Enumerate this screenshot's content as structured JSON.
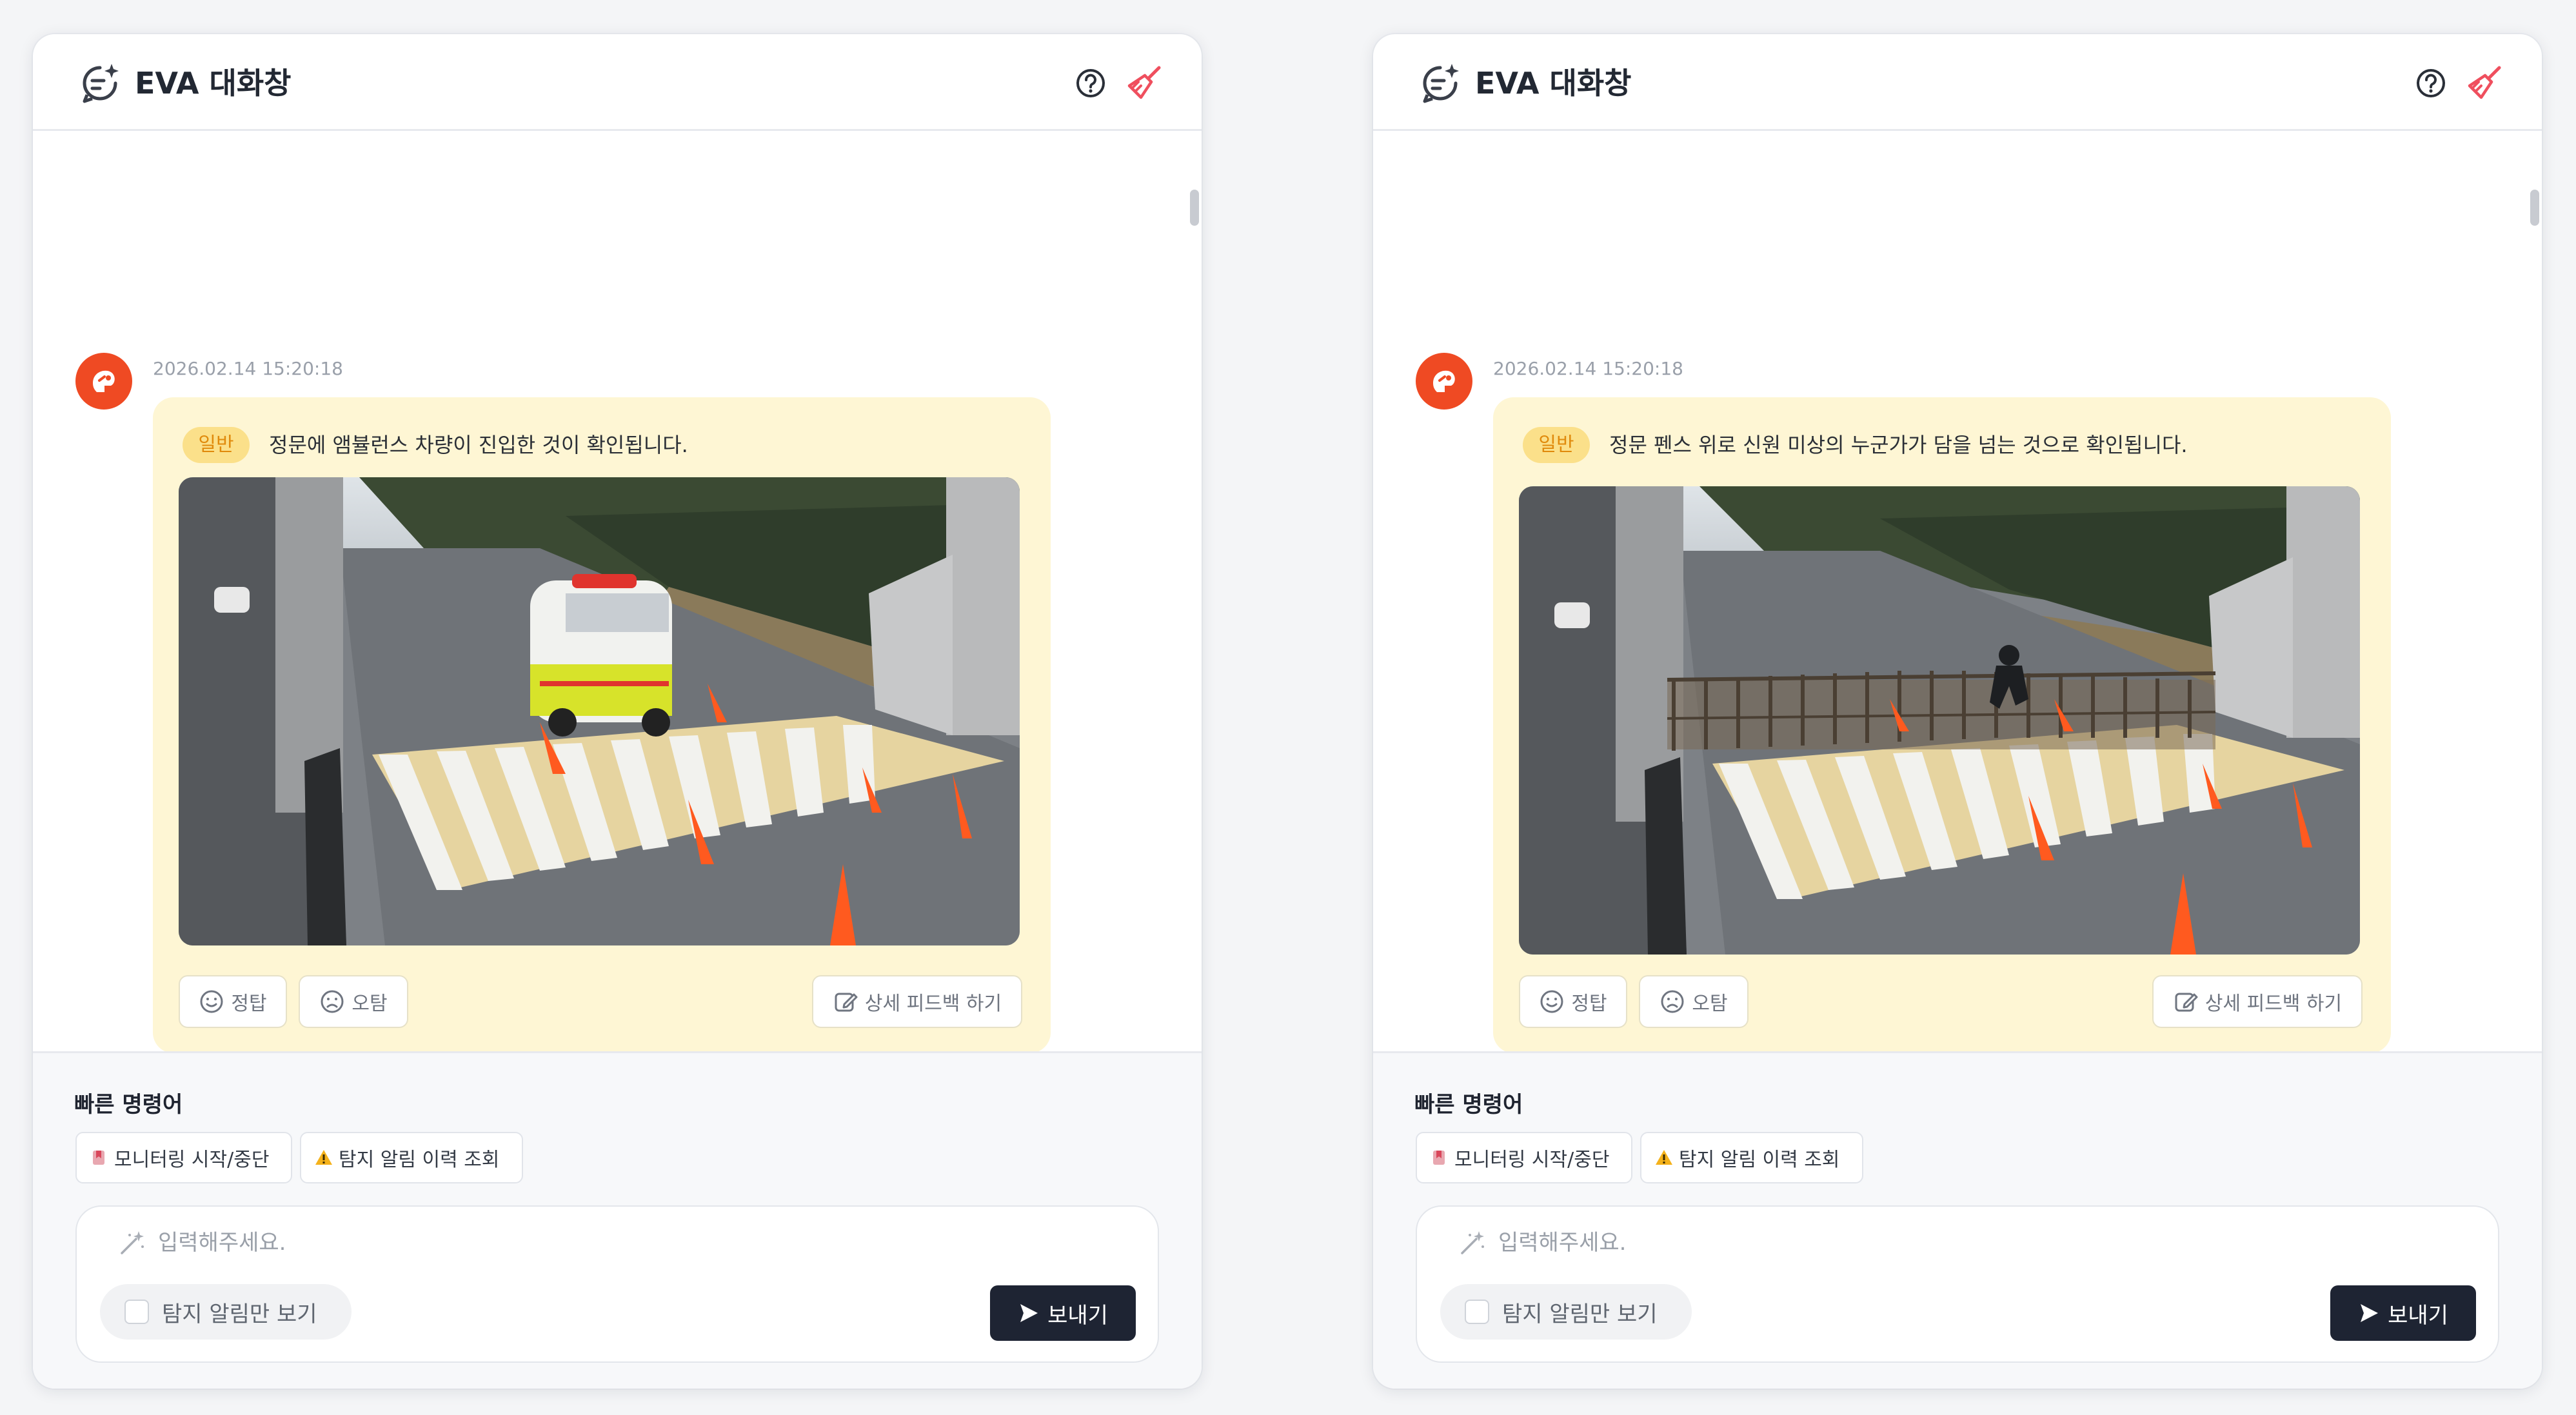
{
  "panels": [
    {
      "header": {
        "title": "EVA 대화창"
      },
      "message": {
        "timestamp": "2026.02.14 15:20:18",
        "badge": "일반",
        "text": "정문에 앰뷸런스 차량이 진입한 것이 확인됩니다.",
        "image": {
          "scene": "ambulance-entering-gate"
        },
        "feedback": {
          "correct": "정탑",
          "wrong": "오탐",
          "detail": "상세 피드백 하기"
        }
      },
      "quick_commands": {
        "title": "빠른 명령어",
        "items": [
          {
            "label": "모니터링 시작/중단"
          },
          {
            "label": "탐지 알림 이력 조회"
          }
        ]
      },
      "input": {
        "placeholder": "입력해주세요.",
        "value": "",
        "filter_label": "탐지 알림만 보기",
        "send_label": "보내기"
      }
    },
    {
      "header": {
        "title": "EVA 대화창"
      },
      "message": {
        "timestamp": "2026.02.14 15:20:18",
        "badge": "일반",
        "text": "정문 펜스 위로 신원 미상의 누군가가 담을 넘는 것으로 확인됩니다.",
        "image": {
          "scene": "person-climbing-gate-fence"
        },
        "feedback": {
          "correct": "정탑",
          "wrong": "오탐",
          "detail": "상세 피드백 하기"
        }
      },
      "quick_commands": {
        "title": "빠른 명령어",
        "items": [
          {
            "label": "모니터링 시작/중단"
          },
          {
            "label": "탐지 알림 이력 조회"
          }
        ]
      },
      "input": {
        "placeholder": "입력해주세요.",
        "value": "",
        "filter_label": "탐지 알림만 보기",
        "send_label": "보내기"
      }
    }
  ],
  "colors": {
    "accent_orange": "#ef4a23",
    "bubble_bg": "#fef6d4",
    "badge_bg": "#fbe08a",
    "badge_text": "#e08a0c",
    "send_button_bg": "#1e2433",
    "clear_icon": "#ef4f5e"
  },
  "icons": {
    "header": [
      "chat-sparkle-icon",
      "help-circle-icon",
      "broom-clear-icon"
    ],
    "feedback": [
      "smile-icon",
      "frown-icon",
      "edit-feedback-icon"
    ],
    "quick": [
      "bookmark-flag-icon",
      "warning-icon"
    ],
    "input": [
      "magic-wand-icon",
      "send-arrow-icon"
    ]
  }
}
